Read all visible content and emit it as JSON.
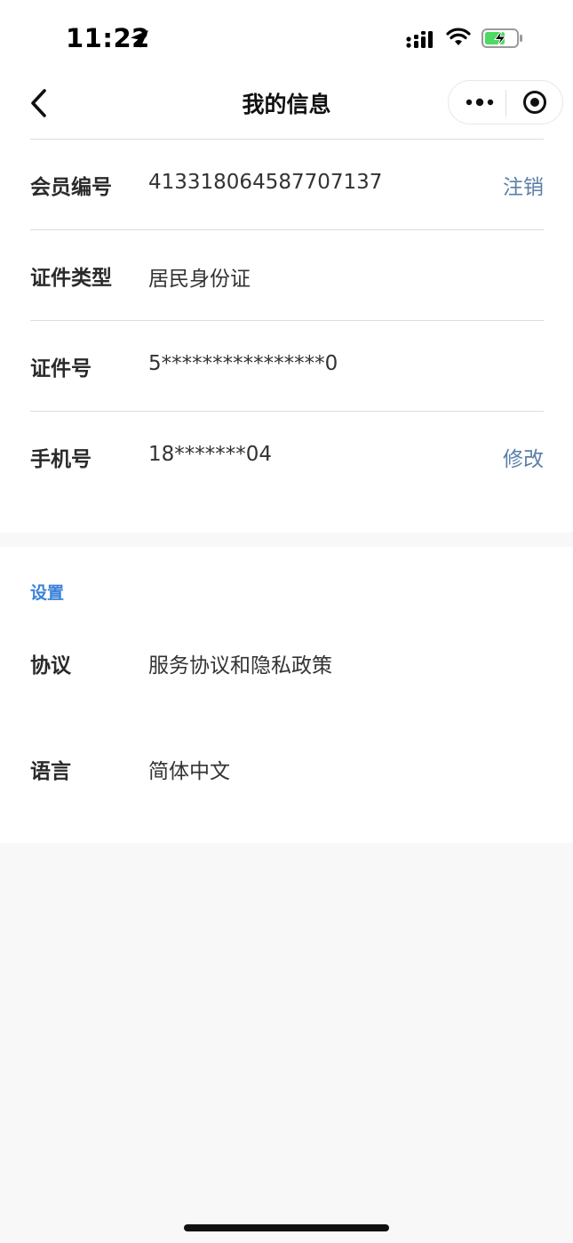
{
  "status_bar": {
    "time": "11:22"
  },
  "nav": {
    "title": "我的信息"
  },
  "info": {
    "rows": [
      {
        "label": "会员编号",
        "value": "413318064587707137",
        "action": "注销"
      },
      {
        "label": "证件类型",
        "value": "居民身份证"
      },
      {
        "label": "证件号",
        "value": "5****************0"
      },
      {
        "label": "手机号",
        "value": "18*******04",
        "action": "修改"
      }
    ]
  },
  "settings": {
    "title": "设置",
    "rows": [
      {
        "label": "协议",
        "value": "服务协议和隐私政策"
      },
      {
        "label": "语言",
        "value": "简体中文"
      }
    ]
  },
  "colors": {
    "action_link": "#5b7fa8",
    "section_title": "#3b82d8",
    "page_background": "#f8f8f8",
    "battery_charge": "#4cd964"
  }
}
